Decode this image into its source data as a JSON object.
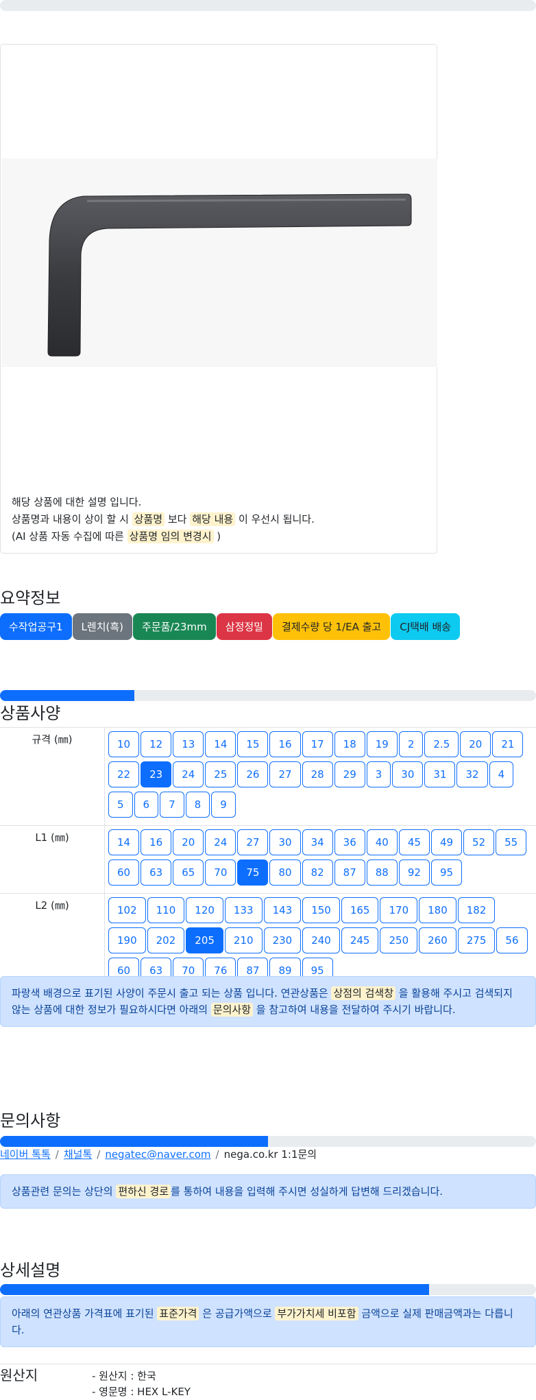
{
  "product": {
    "description_lines": {
      "line1": "해당 상품에 대한 설명 입니다.",
      "line2_a": "상품명과 내용이 상이 할 시 ",
      "line2_hl1": "상품명",
      "line2_b": " 보다 ",
      "line2_hl2": "해당 내용",
      "line2_c": " 이 우선시 됩니다.",
      "line3_a": "(AI 상품 자동 수집에 따른 ",
      "line3_hl": "상품명 임의 변경시",
      "line3_b": " )"
    }
  },
  "summary": {
    "title": "요약정보",
    "badges": [
      {
        "label": "수작업공구1",
        "color": "#0d6efd"
      },
      {
        "label": "L렌치(흑)",
        "color": "#6c757d"
      },
      {
        "label": "주문품/23mm",
        "color": "#198754"
      },
      {
        "label": "삼정정밀",
        "color": "#dc3545"
      },
      {
        "label": "결제수량 당 1/EA 출고",
        "color": "#ffc107"
      },
      {
        "label": "CJ택배 배송",
        "color": "#0dcaf0"
      }
    ]
  },
  "spec": {
    "progress": 0.25,
    "title": "상품사양",
    "rows": [
      {
        "label": "규격 (㎜)",
        "selected": "23",
        "values": [
          "10",
          "12",
          "13",
          "14",
          "15",
          "16",
          "17",
          "18",
          "19",
          "2",
          "2.5",
          "20",
          "21",
          "22",
          "23",
          "24",
          "25",
          "26",
          "27",
          "28",
          "29",
          "3",
          "30",
          "31",
          "32",
          "4",
          "5",
          "6",
          "7",
          "8",
          "9"
        ]
      },
      {
        "label": "L1 (㎜)",
        "selected": "75",
        "values": [
          "14",
          "16",
          "20",
          "24",
          "27",
          "30",
          "34",
          "36",
          "40",
          "45",
          "49",
          "52",
          "55",
          "60",
          "63",
          "65",
          "70",
          "75",
          "80",
          "82",
          "87",
          "88",
          "92",
          "95"
        ]
      },
      {
        "label": "L2 (㎜)",
        "selected": "205",
        "values": [
          "102",
          "110",
          "120",
          "133",
          "143",
          "150",
          "165",
          "170",
          "180",
          "182",
          "190",
          "202",
          "205",
          "210",
          "230",
          "240",
          "245",
          "250",
          "260",
          "275",
          "56",
          "60",
          "63",
          "70",
          "76",
          "87",
          "89",
          "95"
        ]
      }
    ],
    "notice": {
      "a": "파랑색 배경으로 표기된 사양이 주문시 출고 되는 상품 입니다. 연관상품은 ",
      "hl1": "상점의 검색창",
      "b": " 을 활용해 주시고 검색되지 않는 상품에 대한 정보가 필요하시다면 아래의 ",
      "hl2": "문의사항",
      "c": " 을 참고하여 내용을 전달하여 주시기 바랍니다."
    }
  },
  "inquiry": {
    "title": "문의사항",
    "progress": 0.5,
    "links": [
      "네이버 톡톡",
      "채널톡",
      "negatec@naver.com"
    ],
    "plain": "nega.co.kr 1:1문의",
    "separator": "/",
    "notice": {
      "a": "상품관련 문의는 상단의 ",
      "hl": "편하신 경로",
      "b": "를 통하여 내용을 입력해 주시면 성실하게 답변해 드리겠습니다."
    }
  },
  "detail": {
    "title": "상세설명",
    "progress": 0.8,
    "notice": {
      "a": "아래의 연관상품 가격표에 표기된 ",
      "hl1": "표준가격",
      "b": " 은 공급가액으로 ",
      "hl2": "부가가치세 비포함",
      "c": " 금액으로 실제 판매금액과는 다릅니다."
    }
  },
  "origin": {
    "label": "원산지",
    "items": [
      "- 원산지 : 한국",
      "- 영문명 : HEX L-KEY"
    ]
  }
}
